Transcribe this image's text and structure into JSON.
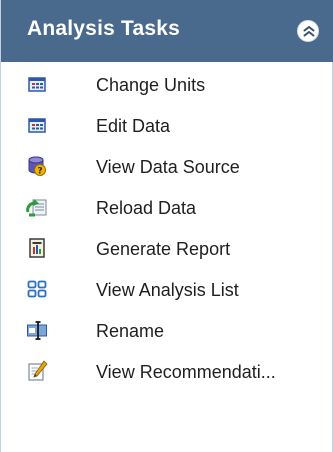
{
  "panel": {
    "title": "Analysis Tasks",
    "collapse_icon": "double-chevron-up-icon"
  },
  "tasks": [
    {
      "label": "Change Units",
      "icon": "units-icon"
    },
    {
      "label": "Edit Data",
      "icon": "edit-data-icon"
    },
    {
      "label": "View Data Source",
      "icon": "data-source-icon"
    },
    {
      "label": "Reload Data",
      "icon": "reload-icon"
    },
    {
      "label": "Generate Report",
      "icon": "report-icon"
    },
    {
      "label": "View Analysis List",
      "icon": "analysis-list-icon"
    },
    {
      "label": "Rename",
      "icon": "rename-icon"
    },
    {
      "label": "View Recommendati...",
      "icon": "recommendation-icon"
    }
  ],
  "colors": {
    "header_bg": "#4a6a8d",
    "header_text": "#ffffff",
    "item_text": "#1f1f1f"
  }
}
